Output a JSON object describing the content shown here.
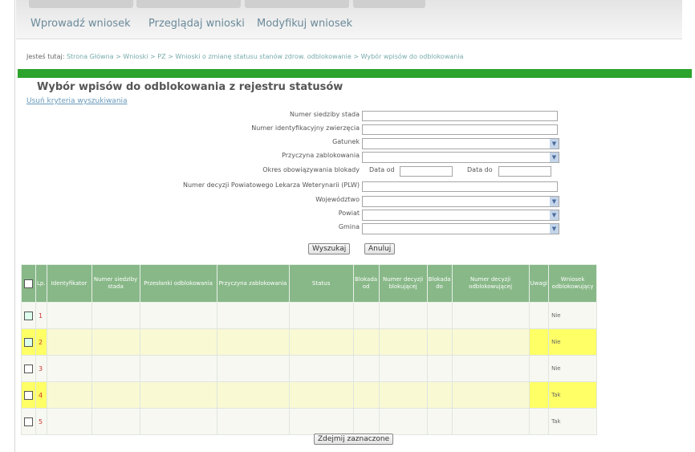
{
  "tabs": [
    {
      "label": "Wprowadź wniosek"
    },
    {
      "label": "Przeglądaj wnioski"
    },
    {
      "label": "Modyfikuj wniosek"
    }
  ],
  "breadcrumb": {
    "prefix": "Jesteś tutaj:",
    "path": "Strona Główna > Wnioski > PZ > Wnioski o zmianę statusu stanów zdrow. odblokowanie > Wybór wpisów do odblokowania"
  },
  "page": {
    "title": "Wybór wpisów do odblokowania z rejestru statusów",
    "clear_link": "Usuń kryteria wyszukiwania"
  },
  "form": {
    "fields": [
      {
        "label": "Numer siedziby stada",
        "type": "input",
        "value": ""
      },
      {
        "label": "Numer identyfikacyjny zwierzęcia",
        "type": "input",
        "value": ""
      },
      {
        "label": "Gatunek",
        "type": "select",
        "value": ""
      },
      {
        "label": "Przyczyna zablokowania",
        "type": "select",
        "value": ""
      },
      {
        "label": "Okres obowiązywania blokady",
        "type": "daterange",
        "value": ""
      },
      {
        "label": "Numer decyzji Powiatowego Lekarza Weterynarii (PLW)",
        "type": "input",
        "value": ""
      },
      {
        "label": "Województwo",
        "type": "select",
        "value": ""
      },
      {
        "label": "Powiat",
        "type": "select",
        "value": ""
      },
      {
        "label": "Gmina",
        "type": "select",
        "value": ""
      }
    ],
    "date_from_label": "Data od",
    "date_to_label": "Data do",
    "search_button": "Wyszukaj",
    "cancel_button": "Anuluj"
  },
  "table": {
    "headers": [
      "Lp.",
      "Identyfikator",
      "Numer siedziby stada",
      "Przesłanki odblokowania",
      "Przyczyna zablokowania",
      "Status",
      "Blokada od",
      "Numer decyzji blokującej",
      "Blokada do",
      "Numer decyzji odblokowującej",
      "Uwagi",
      "Wniosek odblokowujący"
    ],
    "rows": [
      {
        "lp": "1",
        "checked": true,
        "wniosek": "Nie",
        "highlight": false
      },
      {
        "lp": "2",
        "checked": true,
        "wniosek": "Nie",
        "highlight": true
      },
      {
        "lp": "3",
        "checked": false,
        "wniosek": "Nie",
        "highlight": false
      },
      {
        "lp": "4",
        "checked": false,
        "wniosek": "Tak",
        "highlight": true
      },
      {
        "lp": "5",
        "checked": false,
        "wniosek": "Tak",
        "highlight": false
      }
    ]
  },
  "footer": {
    "unlock_button": "Zdejmij zaznaczone"
  },
  "colors": {
    "green_bar": "#2ca32c",
    "header_green": "#88b888",
    "highlight": "#ffff66"
  }
}
